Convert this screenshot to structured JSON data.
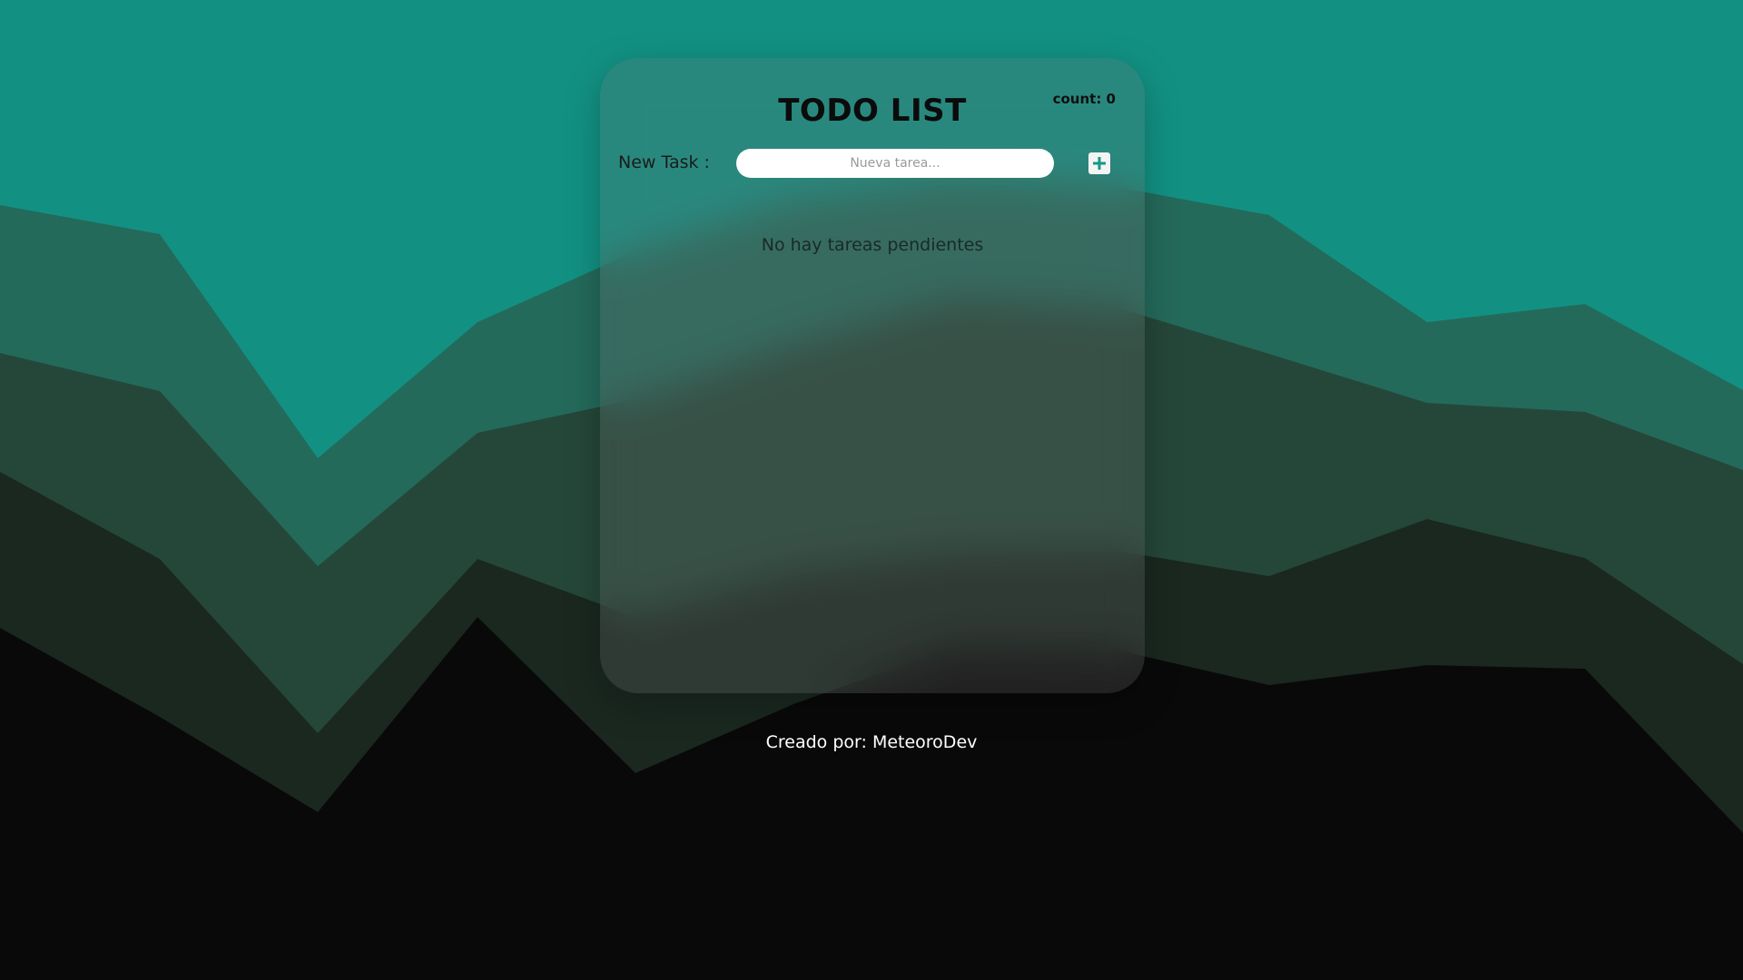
{
  "app": {
    "title": "TODO LIST",
    "count_label": "count: 0"
  },
  "new_task": {
    "label": "New Task :",
    "placeholder": "Nueva tarea...",
    "value": "",
    "add_icon": "plus-icon"
  },
  "tasks": {
    "items": [],
    "empty_message": "No hay tareas pendientes"
  },
  "footer": {
    "credit": "Creado por: MeteoroDev"
  },
  "colors": {
    "sky": "#129183",
    "layer1": "#246a5b",
    "layer2": "#254739",
    "layer3": "#1a2820",
    "ground": "#090909",
    "accent": "#139a88"
  }
}
